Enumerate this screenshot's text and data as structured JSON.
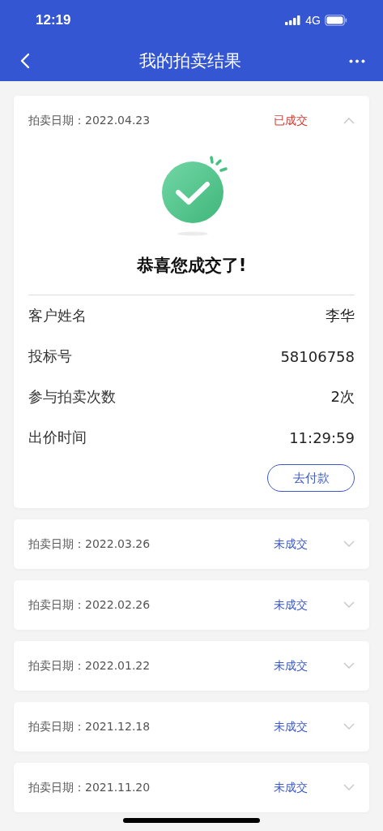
{
  "status_bar": {
    "time": "12:19",
    "network": "4G"
  },
  "nav": {
    "title": "我的拍卖结果"
  },
  "auctions": [
    {
      "date_label": "拍卖日期：2022.04.23",
      "status": "已成交",
      "deal": true,
      "expanded": true,
      "detail": {
        "message": "恭喜您成交了!",
        "fields": [
          {
            "label": "客户姓名",
            "value": "李华"
          },
          {
            "label": "投标号",
            "value": "58106758"
          },
          {
            "label": "参与拍卖次数",
            "value": "2次"
          },
          {
            "label": "出价时间",
            "value": "11:29:59"
          }
        ],
        "button": "去付款"
      }
    },
    {
      "date_label": "拍卖日期：2022.03.26",
      "status": "未成交",
      "deal": false,
      "expanded": false
    },
    {
      "date_label": "拍卖日期：2022.02.26",
      "status": "未成交",
      "deal": false,
      "expanded": false
    },
    {
      "date_label": "拍卖日期：2022.01.22",
      "status": "未成交",
      "deal": false,
      "expanded": false
    },
    {
      "date_label": "拍卖日期：2021.12.18",
      "status": "未成交",
      "deal": false,
      "expanded": false
    },
    {
      "date_label": "拍卖日期：2021.11.20",
      "status": "未成交",
      "deal": false,
      "expanded": false
    }
  ]
}
